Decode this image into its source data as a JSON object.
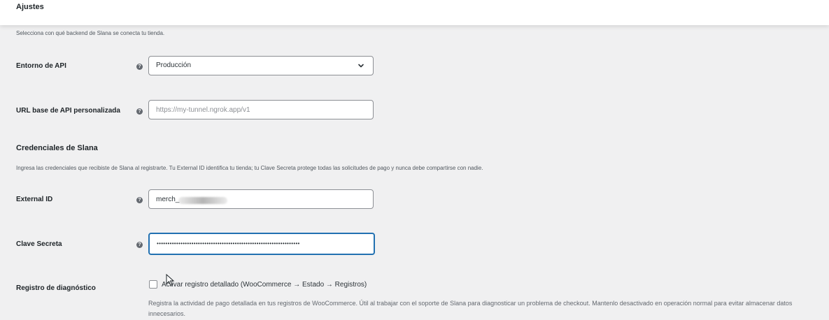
{
  "header": {
    "title": "Ajustes"
  },
  "intro": "Selecciona con qué backend de Slana se conecta tu tienda.",
  "api_environment": {
    "label": "Entorno de API",
    "selected": "Producción"
  },
  "custom_base_url": {
    "label": "URL base de API personalizada",
    "placeholder": "https://my-tunnel.ngrok.app/v1",
    "value": ""
  },
  "credentials": {
    "title": "Credenciales de Slana",
    "description": "Ingresa las credenciales que recibiste de Slana al registrarte. Tu External ID identifica tu tienda; tu Clave Secreta protege todas las solicitudes de pago y nunca debe compartirse con nadie."
  },
  "external_id": {
    "label": "External ID",
    "value": "merch_"
  },
  "secret_key": {
    "label": "Clave Secreta",
    "value": "••••••••••••••••••••••••••••••••••••••••••••••••••••••••••••••••••"
  },
  "diagnostics": {
    "label": "Registro de diagnóstico",
    "checkbox_label": "Activar registro detallado (WooCommerce → Estado → Registros)",
    "checked": false,
    "description": "Registra la actividad de pago detallada en tus registros de WooCommerce. Útil al trabajar con el soporte de Slana para diagnosticar un problema de checkout. Mantenlo desactivado en operación normal para evitar almacenar datos innecesarios."
  },
  "icons": {
    "help": "help-icon",
    "dropdown": "chevron-down-icon",
    "cursor": "mouse-pointer-icon"
  },
  "colors": {
    "focus": "#2271b1",
    "background": "#f0f0f1",
    "text": "#1d2327"
  }
}
